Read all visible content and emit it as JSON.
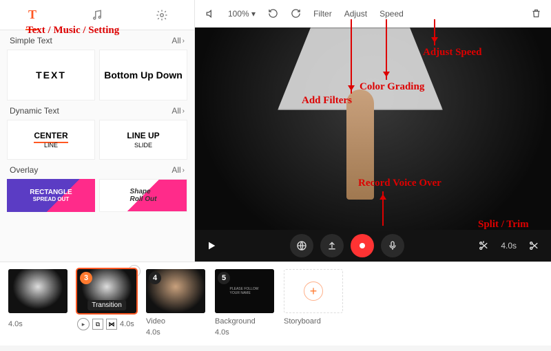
{
  "tabs": {
    "text": "T",
    "music": "♫",
    "settings": "⚙"
  },
  "annotations": {
    "tabs_label": "Text / Music / Setting",
    "filters": "Add Filters",
    "grading": "Color Grading",
    "speed": "Adjust Speed",
    "voice": "Record Voice Over",
    "split": "Split / Trim"
  },
  "sidebar": {
    "simple": {
      "title": "Simple Text",
      "all": "All",
      "cards": [
        "TEXT",
        "Bottom Up Down"
      ]
    },
    "dynamic": {
      "title": "Dynamic Text",
      "all": "All",
      "cards_center": "CENTER",
      "cards_center_sub": "LINE",
      "cards_lineup": "LINE UP",
      "cards_lineup_sub": "SLIDE"
    },
    "overlay": {
      "title": "Overlay",
      "all": "All",
      "card1_a": "RECTANGLE",
      "card1_b": "SPREAD OUT",
      "card2_a": "Shape",
      "card2_b": "Roll Out"
    }
  },
  "toolbar": {
    "zoom": "100% ▾",
    "filter": "Filter",
    "adjust": "Adjust",
    "speed": "Speed"
  },
  "playbar": {
    "duration": "4.0s"
  },
  "timeline": {
    "clips": [
      {
        "dur": "4.0s"
      },
      {
        "num": "3",
        "tooltip": "Transition",
        "dur": "4.0s"
      },
      {
        "num": "4",
        "label": "Video",
        "dur": "4.0s"
      },
      {
        "num": "5",
        "label": "Background",
        "dur": "4.0s"
      }
    ],
    "add_label": "Storyboard"
  }
}
